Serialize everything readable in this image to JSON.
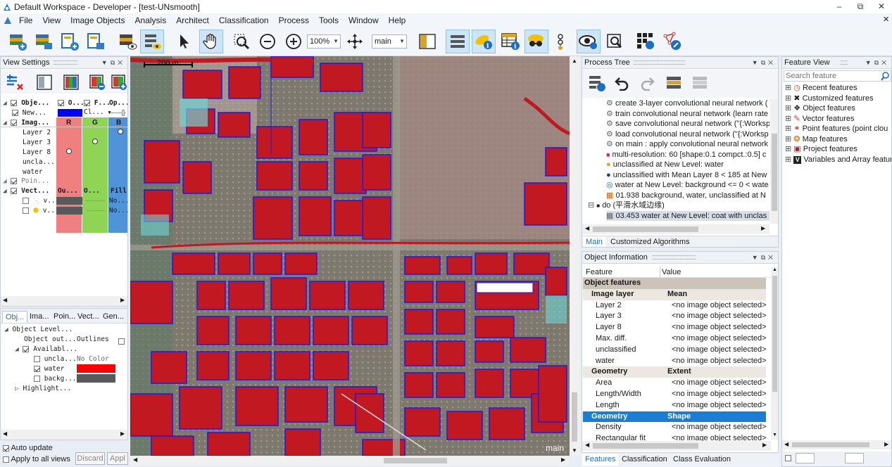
{
  "window": {
    "title": "Default Workspace - Developer - [test-UNsmooth]"
  },
  "menu": [
    "File",
    "View",
    "Image Objects",
    "Analysis",
    "Architect",
    "Classification",
    "Process",
    "Tools",
    "Window",
    "Help"
  ],
  "toolbar": {
    "zoom": "100%",
    "map": "main"
  },
  "view_settings": {
    "title": "View Settings",
    "headers": {
      "obj": "Obje...",
      "o": "O...",
      "f": "F...",
      "op": "Op..."
    },
    "new_row": {
      "label": "New...",
      "cl": "Cl..."
    },
    "image_header": "Imag...",
    "rgb": [
      "R",
      "G",
      "B"
    ],
    "layers": [
      "Layer 2",
      "Layer 3",
      "Layer 8",
      "uncla...",
      "water"
    ],
    "points": "Poin...",
    "vector_header": {
      "label": "Vect...",
      "ou": "Ou...",
      "o": "O...",
      "fill": "Fill"
    },
    "vector_rows": [
      {
        "label": "v...",
        "fill": "No..."
      },
      {
        "label": "v...",
        "fill": "No..."
      }
    ]
  },
  "lower_left": {
    "tabs": [
      "Obj...",
      "Ima...",
      "Poin...",
      "Vect...",
      "Gen..."
    ],
    "object_level": "Object Level...",
    "object_outlines": {
      "label": "Object out...",
      "value": "Outlines"
    },
    "available": "Availabl...",
    "classes": [
      {
        "label": "uncla...",
        "value": "No Color"
      },
      {
        "label": "water",
        "value": ""
      },
      {
        "label": "backg...",
        "value": ""
      }
    ],
    "highlight": "Highlight...",
    "auto_update": "Auto update",
    "apply_all": "Apply to all views",
    "discard": "Discard",
    "apply": "Appl"
  },
  "map": {
    "scale_label": "200 m",
    "view_label": "main"
  },
  "process_tree": {
    "title": "Process Tree",
    "rows": [
      "create 3-layer convolutional neural network (",
      "train convolutional neural network (learn rate",
      "save convolutional neural network (\"{:Worksp",
      "load convolutional neural network (\"{:Worksp",
      "on main : apply convolutional neural network",
      "multi-resolution: 60 [shape:0.1 compct.:0.5] c",
      "unclassified at New Level: water",
      "unclassified with Mean Layer 8 < 185  at New",
      "water at New Level: background <= 0 < wate",
      "01.938   background, water, unclassified at N",
      "do  (平滑水域边缘)",
      "03.453   water at New Level: coat with unclas"
    ],
    "tabs": [
      "Main",
      "Customized Algorithms"
    ]
  },
  "object_info": {
    "title": "Object Information",
    "columns": [
      "Feature",
      "Value"
    ],
    "rows": [
      {
        "kind": "cat",
        "feature": "Object features",
        "value": ""
      },
      {
        "kind": "sub",
        "feature": "Image layer",
        "value": "Mean"
      },
      {
        "kind": "item",
        "feature": "Layer 2",
        "value": "<no image object selected>"
      },
      {
        "kind": "item",
        "feature": "Layer 3",
        "value": "<no image object selected>"
      },
      {
        "kind": "item",
        "feature": "Layer 8",
        "value": "<no image object selected>"
      },
      {
        "kind": "item",
        "feature": "Max. diff.",
        "value": "<no image object selected>"
      },
      {
        "kind": "item",
        "feature": "unclassified",
        "value": "<no image object selected>"
      },
      {
        "kind": "item",
        "feature": "water",
        "value": "<no image object selected>"
      },
      {
        "kind": "sub",
        "feature": "Geometry",
        "value": "Extent"
      },
      {
        "kind": "item",
        "feature": "Area",
        "value": "<no image object selected>"
      },
      {
        "kind": "item",
        "feature": "Length/Width",
        "value": "<no image object selected>"
      },
      {
        "kind": "item",
        "feature": "Length",
        "value": "<no image object selected>"
      },
      {
        "kind": "sel",
        "feature": "Geometry",
        "value": "Shape"
      },
      {
        "kind": "item",
        "feature": "Density",
        "value": "<no image object selected>"
      },
      {
        "kind": "item",
        "feature": "Rectangular fit",
        "value": "<no image object selected>"
      }
    ],
    "tabs": [
      "Features",
      "Classification",
      "Class Evaluation"
    ]
  },
  "feature_view": {
    "title": "Feature View",
    "search_placeholder": "Search feature",
    "items": [
      "Recent features",
      "Customized features",
      "Object features",
      "Vector features",
      "Point features (point clou",
      "Map features",
      "Project features",
      "Variables and Array featur"
    ]
  },
  "colors": {
    "water": "#ff0000",
    "background": "#595959",
    "accent": "#1a7fd4",
    "new_class": "#0000ff"
  }
}
